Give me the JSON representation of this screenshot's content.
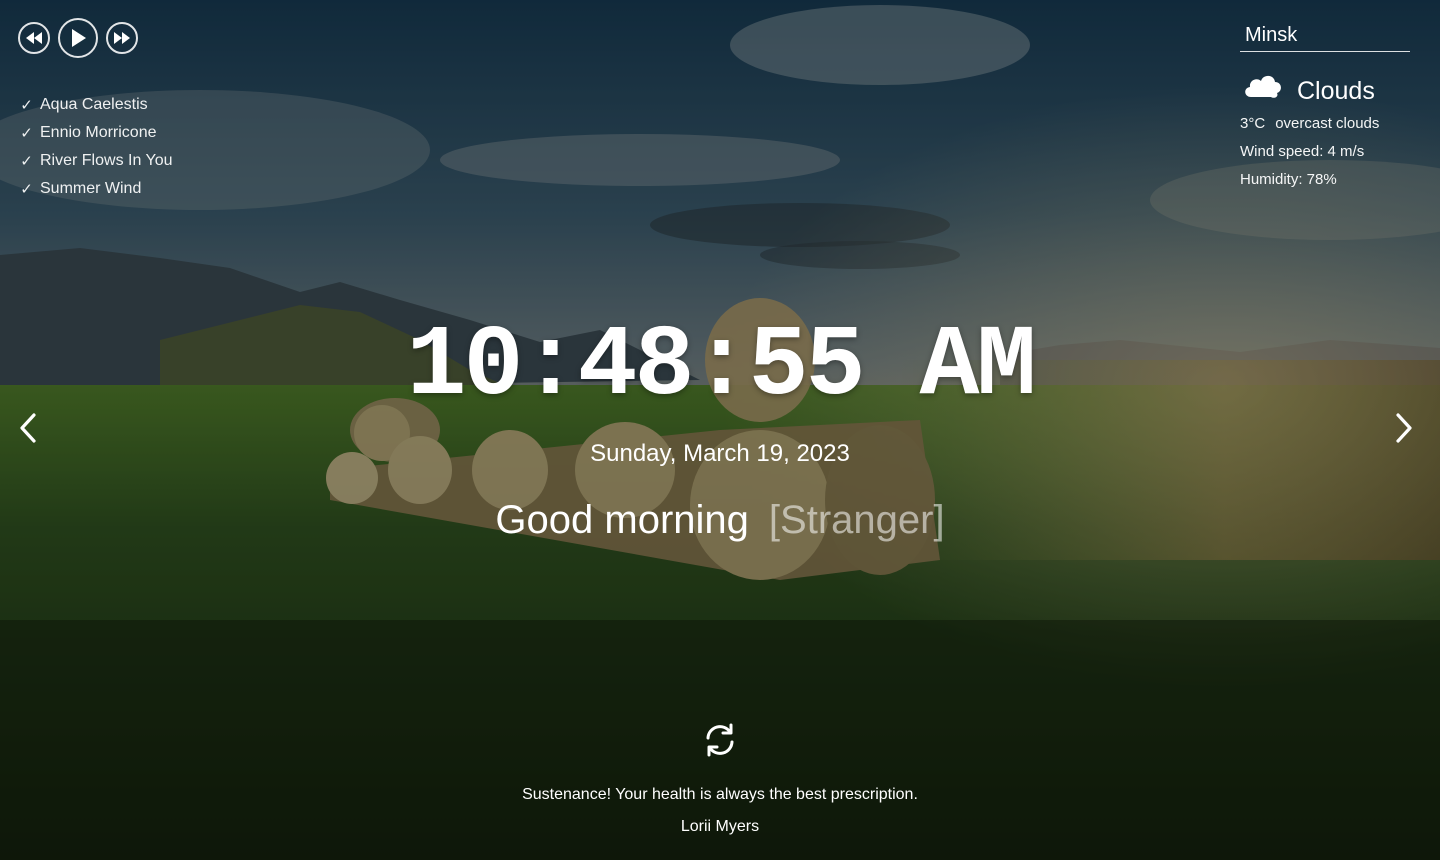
{
  "player": {
    "prev_icon": "rewind-icon",
    "play_icon": "play-icon",
    "next_icon": "fast-forward-icon",
    "playlist": [
      {
        "check": "✓",
        "title": "Aqua Caelestis"
      },
      {
        "check": "✓",
        "title": "Ennio Morricone"
      },
      {
        "check": "✓",
        "title": "River Flows In You"
      },
      {
        "check": "✓",
        "title": "Summer Wind"
      }
    ]
  },
  "weather": {
    "city": "Minsk",
    "icon": "cloud-icon",
    "description": "Clouds",
    "temperature": "3°C",
    "details": "overcast clouds",
    "wind": "Wind speed: 4 m/s",
    "humidity": "Humidity: 78%"
  },
  "slider": {
    "prev_icon": "chevron-left-icon",
    "next_icon": "chevron-right-icon"
  },
  "clock": {
    "time": "10:48:55 AM",
    "date": "Sunday, March 19, 2023"
  },
  "greeting": {
    "text": "Good morning",
    "name": "[Stranger]"
  },
  "quote": {
    "refresh_icon": "refresh-icon",
    "text": "Sustenance! Your health is always the best prescription.",
    "author": "Lorii Myers"
  },
  "colors": {
    "text": "#ffffff",
    "muted_name": "#a9aaa8"
  }
}
